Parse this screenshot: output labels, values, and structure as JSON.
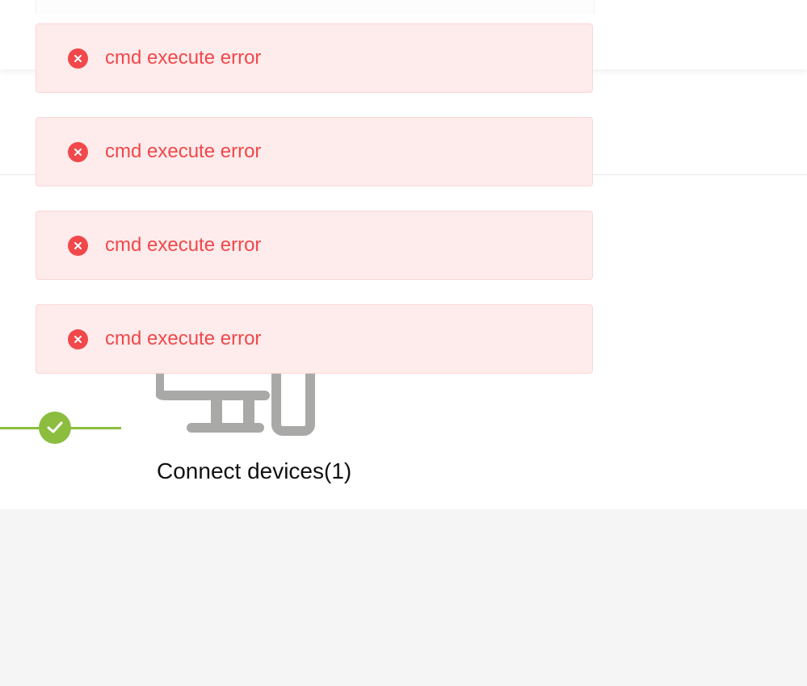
{
  "toasts": [
    {
      "message": "cmd execute error",
      "icon": "close-circle-icon",
      "type": "error"
    },
    {
      "message": "cmd execute error",
      "icon": "close-circle-icon",
      "type": "error"
    },
    {
      "message": "cmd execute error",
      "icon": "close-circle-icon",
      "type": "error"
    },
    {
      "message": "cmd execute error",
      "icon": "close-circle-icon",
      "type": "error"
    }
  ],
  "progress": {
    "status_icon": "checkmark-icon",
    "status": "completed"
  },
  "device": {
    "icon": "computer-monitor-icon",
    "label": "Connect devices(1)"
  },
  "colors": {
    "error_text": "#f0484b",
    "error_background": "#feebeb",
    "success": "#8cbd3f",
    "device_icon": "#a9a9a7"
  }
}
